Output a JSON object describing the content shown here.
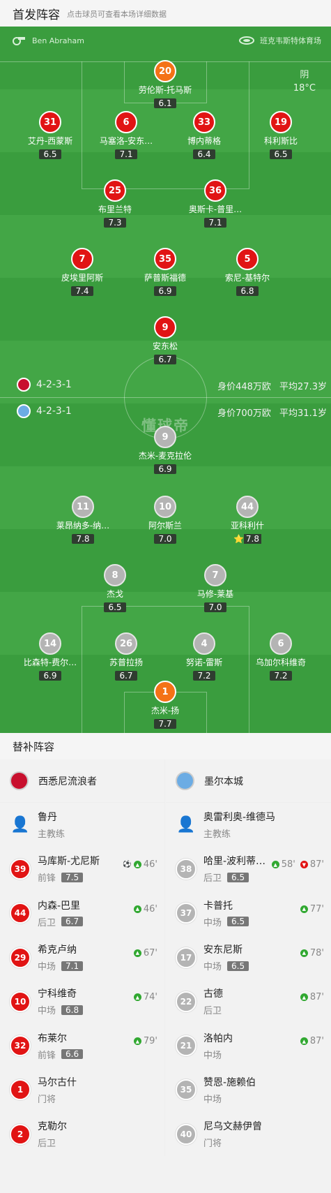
{
  "header": {
    "title": "首发阵容",
    "hint": "点击球员可查看本场详细数据"
  },
  "field": {
    "home_coach_label": "Ben Abraham",
    "stadium": "班克韦斯特体育场",
    "weather": {
      "condition": "阴",
      "temp": "18°C"
    },
    "watermark": "懂球帝",
    "home_formation": "4-2-3-1",
    "away_formation": "4-2-3-1",
    "home_value": "身价448万欧 平均27.3岁",
    "away_value": "身价700万欧 平均31.1岁"
  },
  "home_players": [
    {
      "num": "20",
      "name": "劳伦斯-托马斯",
      "rating": "6.1",
      "color": "ora"
    },
    {
      "num": "31",
      "name": "艾丹-西蒙斯",
      "rating": "6.5",
      "color": "red",
      "sub": "67'"
    },
    {
      "num": "6",
      "name": "马塞洛-安东…",
      "rating": "7.1",
      "color": "red",
      "captain": true
    },
    {
      "num": "33",
      "name": "博内蒂格",
      "rating": "6.4",
      "color": "red",
      "sub": "46'"
    },
    {
      "num": "19",
      "name": "科利斯比",
      "rating": "6.5",
      "color": "red"
    },
    {
      "num": "25",
      "name": "布里兰特",
      "rating": "7.3",
      "color": "red"
    },
    {
      "num": "36",
      "name": "奥斯卡-普里…",
      "rating": "7.1",
      "color": "red"
    },
    {
      "num": "7",
      "name": "皮埃里阿斯",
      "rating": "7.4",
      "color": "red"
    },
    {
      "num": "35",
      "name": "萨普斯福德",
      "rating": "6.9",
      "color": "red",
      "sub": "79'"
    },
    {
      "num": "5",
      "name": "索尼-基特尔",
      "rating": "6.8",
      "color": "red",
      "sub": "74'"
    },
    {
      "num": "9",
      "name": "安东松",
      "rating": "6.7",
      "color": "red",
      "sub": "46'"
    }
  ],
  "away_players": [
    {
      "num": "9",
      "name": "杰米-麦克拉伦",
      "rating": "6.9",
      "color": "gry",
      "captain": true
    },
    {
      "num": "11",
      "name": "莱昂纳多-纳…",
      "rating": "7.8",
      "color": "gry",
      "sub": "58'",
      "goal": true
    },
    {
      "num": "10",
      "name": "阿尔斯兰",
      "rating": "7.0",
      "color": "gry",
      "sub": "77'"
    },
    {
      "num": "44",
      "name": "亚科利什",
      "rating": "7.8",
      "color": "gry",
      "goal": true,
      "star": "⭐"
    },
    {
      "num": "8",
      "name": "杰戈",
      "rating": "6.5",
      "color": "gry"
    },
    {
      "num": "7",
      "name": "马修-莱基",
      "rating": "7.0",
      "color": "gry",
      "sub": "78'",
      "assist": true
    },
    {
      "num": "14",
      "name": "比森特-费尔…",
      "rating": "6.9",
      "color": "gry",
      "sub": "87'",
      "yellow": true
    },
    {
      "num": "26",
      "name": "苏普拉扬",
      "rating": "6.7",
      "color": "gry",
      "yellow": true
    },
    {
      "num": "4",
      "name": "努诺-雷斯",
      "rating": "7.2",
      "color": "gry",
      "yellow": true
    },
    {
      "num": "6",
      "name": "乌加尔科维奇",
      "rating": "7.2",
      "color": "gry",
      "assist": true
    },
    {
      "num": "1",
      "name": "杰米-扬",
      "rating": "7.7",
      "color": "ora"
    }
  ],
  "subs": {
    "title": "替补阵容",
    "home_team": "西悉尼流浪者",
    "away_team": "墨尔本城",
    "home": [
      {
        "num": "",
        "name": "鲁丹",
        "pos": "主教练",
        "coach": true
      },
      {
        "num": "39",
        "name": "马库斯-尤尼斯",
        "pos": "前锋",
        "rating": "7.5",
        "ev": "46'",
        "goal": true,
        "type": "up"
      },
      {
        "num": "44",
        "name": "内森-巴里",
        "pos": "后卫",
        "rating": "6.7",
        "ev": "46'",
        "type": "up"
      },
      {
        "num": "29",
        "name": "希克卢纳",
        "pos": "中场",
        "rating": "7.1",
        "ev": "67'",
        "type": "up"
      },
      {
        "num": "10",
        "name": "宁科维奇",
        "pos": "中场",
        "rating": "6.8",
        "ev": "74'",
        "type": "up"
      },
      {
        "num": "32",
        "name": "布莱尔",
        "pos": "前锋",
        "rating": "6.6",
        "ev": "79'",
        "type": "up"
      },
      {
        "num": "1",
        "name": "马尔古什",
        "pos": "门将"
      },
      {
        "num": "2",
        "name": "克勒尔",
        "pos": "后卫"
      }
    ],
    "away": [
      {
        "num": "",
        "name": "奥雷利奥-维德马",
        "pos": "主教练",
        "coach": true
      },
      {
        "num": "38",
        "name": "哈里-波利蒂…",
        "pos": "后卫",
        "rating": "6.5",
        "ev": "58'",
        "ev2": "87'",
        "type": "updown"
      },
      {
        "num": "37",
        "name": "卡普托",
        "pos": "中场",
        "rating": "6.5",
        "ev": "77'",
        "type": "up"
      },
      {
        "num": "17",
        "name": "安东尼斯",
        "pos": "中场",
        "rating": "6.5",
        "ev": "78'",
        "type": "up"
      },
      {
        "num": "22",
        "name": "古德",
        "pos": "后卫",
        "ev": "87'",
        "type": "up"
      },
      {
        "num": "21",
        "name": "洛帕内",
        "pos": "中场",
        "ev": "87'",
        "type": "up"
      },
      {
        "num": "35",
        "name": "赞恩-施赖伯",
        "pos": "中场"
      },
      {
        "num": "40",
        "name": "尼乌文赫伊曾",
        "pos": "门将"
      }
    ]
  },
  "colors": {
    "pitch": "#3a9d3e",
    "home": "#e11414",
    "away": "#b4b4b4",
    "gk": "#f47216"
  }
}
